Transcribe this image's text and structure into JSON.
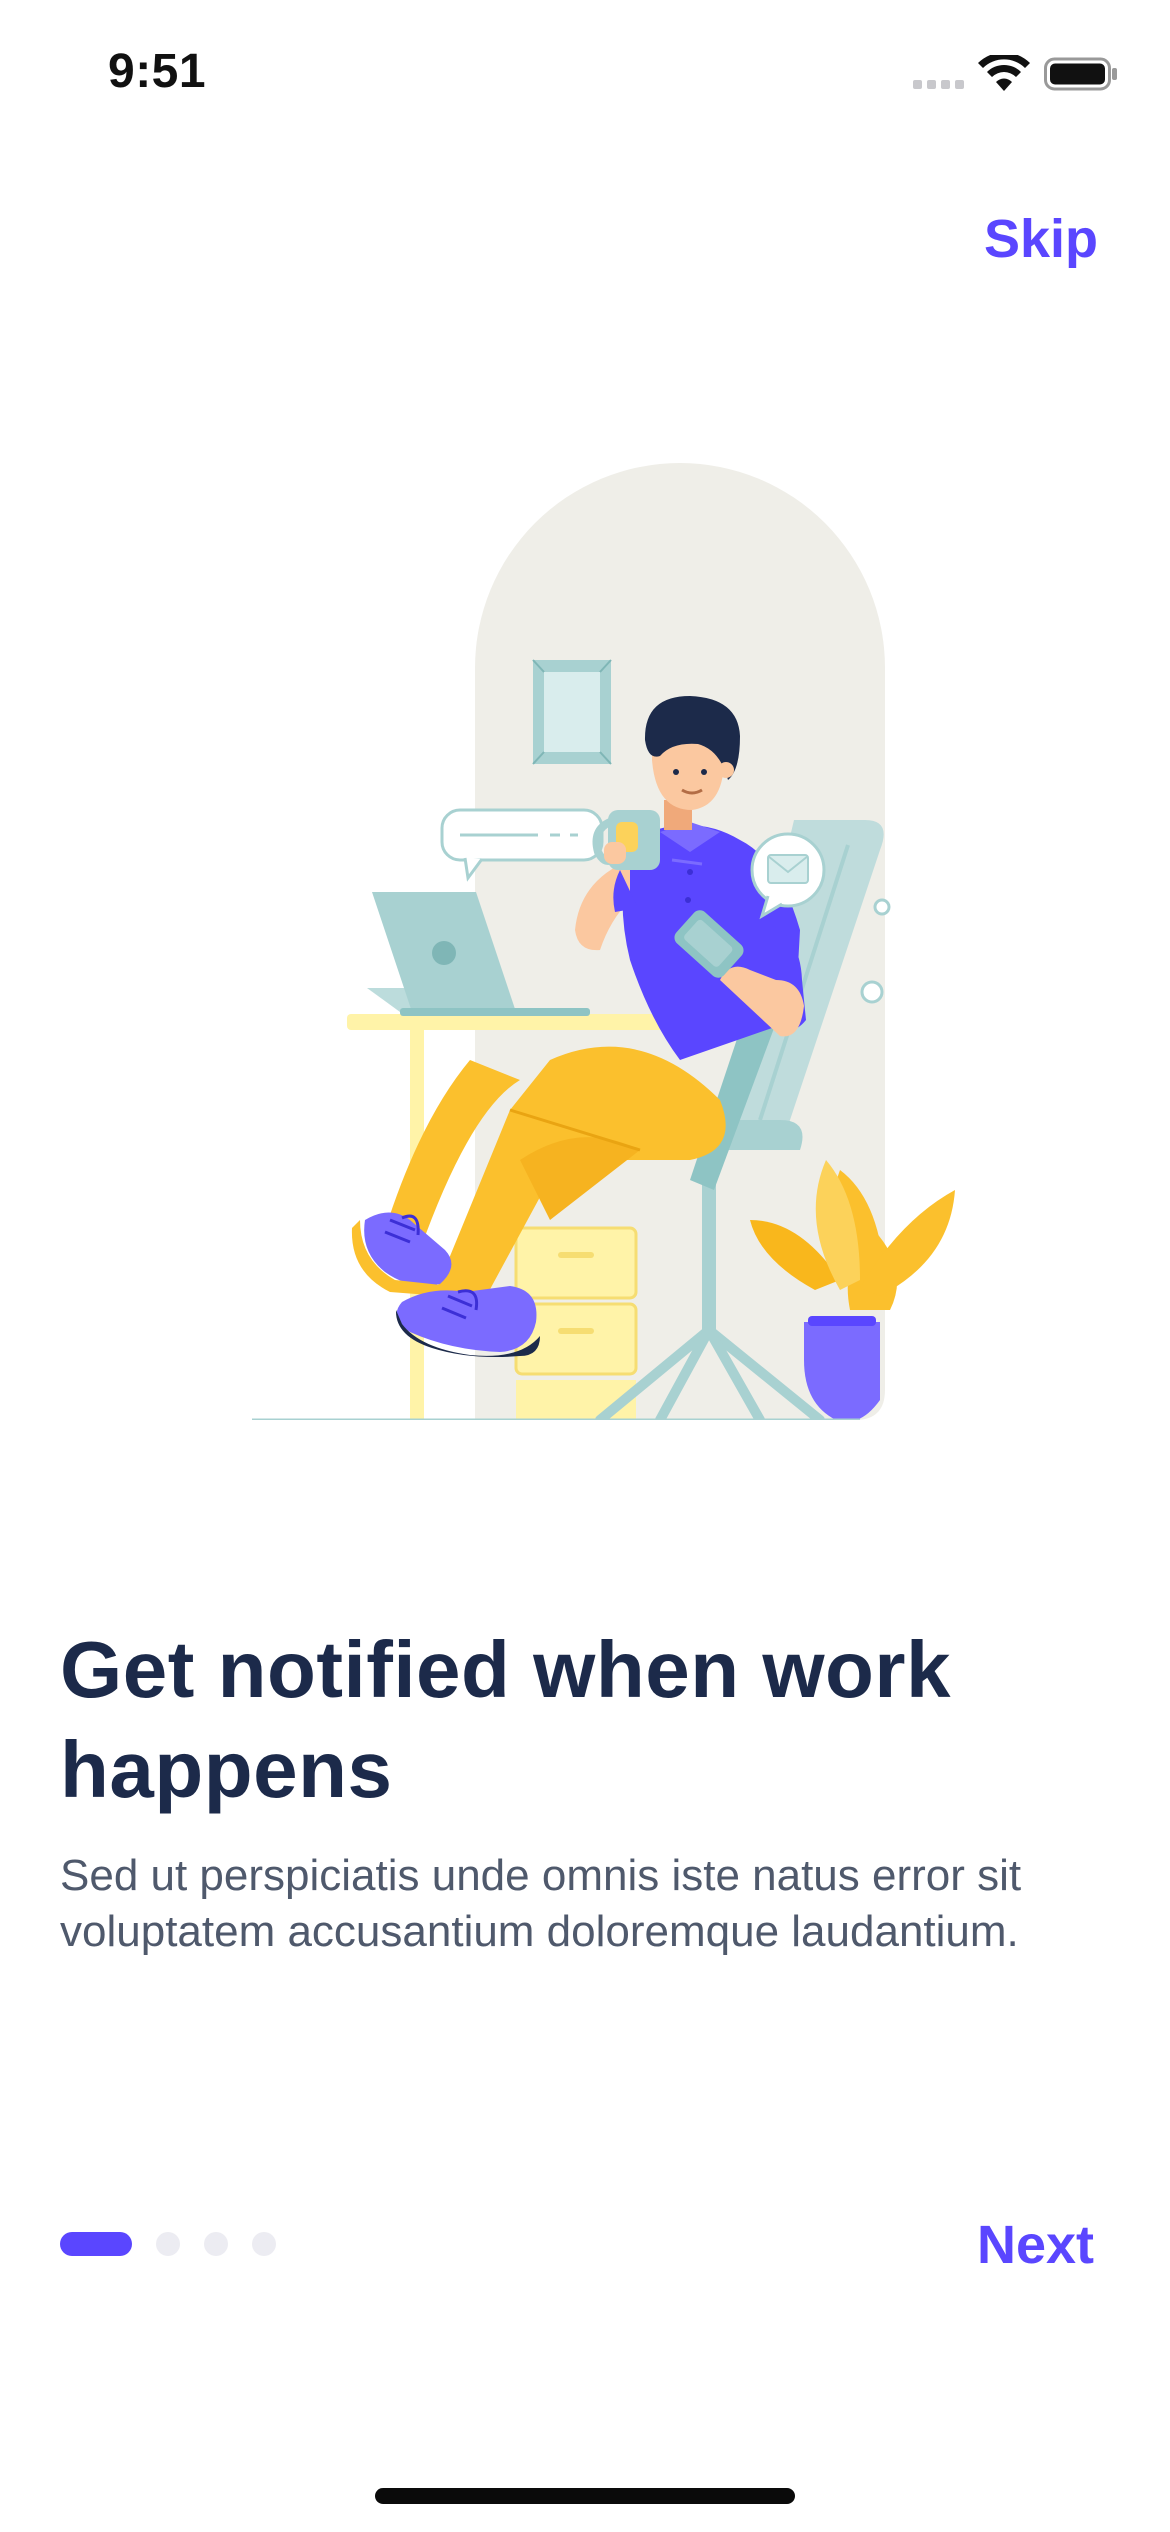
{
  "status_bar": {
    "time": "9:51",
    "icons": [
      "signal-icon",
      "wifi-icon",
      "battery-icon"
    ]
  },
  "header": {
    "skip_label": "Skip"
  },
  "illustration": {
    "subject": "person-relaxing-in-chair-with-coffee-and-phone-icon",
    "colors": {
      "accent": "#5a46ff",
      "yellow": "#fbc02d",
      "teal": "#a8d1d1",
      "backdrop": "#efeee8",
      "navy": "#1c2a4a"
    }
  },
  "content": {
    "title": "Get notified when work happens",
    "description": "Sed ut perspiciatis unde omnis iste natus error sit voluptatem accusantium doloremque laudantium."
  },
  "pagination": {
    "total_pages": 4,
    "current_page": 1
  },
  "footer": {
    "next_label": "Next"
  },
  "colors": {
    "accent": "#5a46ff",
    "title": "#1c2a4a",
    "body_text": "#4f596c",
    "dot_inactive": "#ececf2"
  }
}
